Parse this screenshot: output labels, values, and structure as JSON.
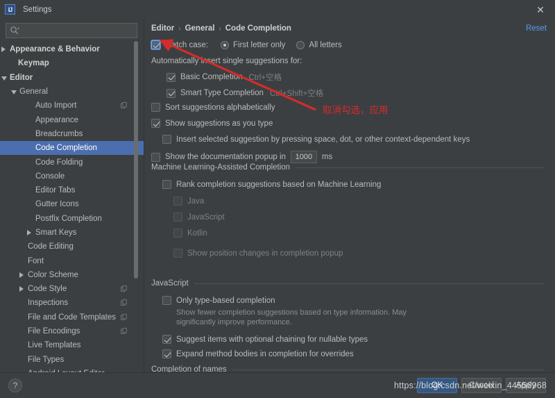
{
  "window": {
    "title": "Settings",
    "app_icon_text": "IJ",
    "close_label": "✕"
  },
  "search": {
    "placeholder": "",
    "value": "",
    "icon": "search-icon"
  },
  "sidebar": {
    "items": [
      {
        "label": "Appearance & Behavior",
        "indent": 14,
        "twisty": "closed",
        "bold": true,
        "selected": false,
        "icon": ""
      },
      {
        "label": "Keymap",
        "indent": 26,
        "twisty": "none",
        "bold": true,
        "selected": false,
        "icon": ""
      },
      {
        "label": "Editor",
        "indent": 14,
        "twisty": "open",
        "bold": true,
        "selected": false,
        "icon": ""
      },
      {
        "label": "General",
        "indent": 28,
        "twisty": "open",
        "bold": false,
        "selected": false,
        "icon": ""
      },
      {
        "label": "Auto Import",
        "indent": 51,
        "twisty": "none",
        "bold": false,
        "selected": false,
        "icon": "copy-icon"
      },
      {
        "label": "Appearance",
        "indent": 51,
        "twisty": "none",
        "bold": false,
        "selected": false,
        "icon": ""
      },
      {
        "label": "Breadcrumbs",
        "indent": 51,
        "twisty": "none",
        "bold": false,
        "selected": false,
        "icon": ""
      },
      {
        "label": "Code Completion",
        "indent": 51,
        "twisty": "none",
        "bold": false,
        "selected": true,
        "icon": ""
      },
      {
        "label": "Code Folding",
        "indent": 51,
        "twisty": "none",
        "bold": false,
        "selected": false,
        "icon": ""
      },
      {
        "label": "Console",
        "indent": 51,
        "twisty": "none",
        "bold": false,
        "selected": false,
        "icon": ""
      },
      {
        "label": "Editor Tabs",
        "indent": 51,
        "twisty": "none",
        "bold": false,
        "selected": false,
        "icon": ""
      },
      {
        "label": "Gutter Icons",
        "indent": 51,
        "twisty": "none",
        "bold": false,
        "selected": false,
        "icon": ""
      },
      {
        "label": "Postfix Completion",
        "indent": 51,
        "twisty": "none",
        "bold": false,
        "selected": false,
        "icon": ""
      },
      {
        "label": "Smart Keys",
        "indent": 51,
        "twisty": "closed",
        "bold": false,
        "selected": false,
        "icon": ""
      },
      {
        "label": "Code Editing",
        "indent": 40,
        "twisty": "none",
        "bold": false,
        "selected": false,
        "icon": ""
      },
      {
        "label": "Font",
        "indent": 40,
        "twisty": "none",
        "bold": false,
        "selected": false,
        "icon": ""
      },
      {
        "label": "Color Scheme",
        "indent": 40,
        "twisty": "closed",
        "bold": false,
        "selected": false,
        "icon": ""
      },
      {
        "label": "Code Style",
        "indent": 40,
        "twisty": "closed",
        "bold": false,
        "selected": false,
        "icon": "copy-icon"
      },
      {
        "label": "Inspections",
        "indent": 40,
        "twisty": "none",
        "bold": false,
        "selected": false,
        "icon": "copy-icon"
      },
      {
        "label": "File and Code Templates",
        "indent": 40,
        "twisty": "none",
        "bold": false,
        "selected": false,
        "icon": "copy-icon"
      },
      {
        "label": "File Encodings",
        "indent": 40,
        "twisty": "none",
        "bold": false,
        "selected": false,
        "icon": "copy-icon"
      },
      {
        "label": "Live Templates",
        "indent": 40,
        "twisty": "none",
        "bold": false,
        "selected": false,
        "icon": ""
      },
      {
        "label": "File Types",
        "indent": 40,
        "twisty": "none",
        "bold": false,
        "selected": false,
        "icon": ""
      },
      {
        "label": "Android Layout Editor",
        "indent": 40,
        "twisty": "none",
        "bold": false,
        "selected": false,
        "icon": ""
      }
    ]
  },
  "breadcrumb": {
    "parts": [
      "Editor",
      "General",
      "Code Completion"
    ],
    "separator": "›"
  },
  "reset": {
    "label": "Reset"
  },
  "options": {
    "match_case": {
      "label": "Match case:",
      "checked": true,
      "radios": [
        {
          "label": "First letter only",
          "selected": true
        },
        {
          "label": "All letters",
          "selected": false
        }
      ]
    },
    "auto_insert_header": "Automatically insert single suggestions for:",
    "basic_completion": {
      "label": "Basic Completion",
      "shortcut": "Ctrl+空格",
      "checked": true
    },
    "smart_type_completion": {
      "label": "Smart Type Completion",
      "shortcut": "Ctrl+Shift+空格",
      "checked": true
    },
    "sort_alphabetically": {
      "label": "Sort suggestions alphabetically",
      "checked": false
    },
    "show_as_you_type": {
      "label": "Show suggestions as you type",
      "checked": true
    },
    "insert_by_keys": {
      "label": "Insert selected suggestion by pressing space, dot, or other context-dependent keys",
      "checked": false
    },
    "doc_popup": {
      "label": "Show the documentation popup in",
      "checked": false,
      "value": "1000",
      "unit": "ms"
    }
  },
  "ml_section": {
    "title": "Machine Learning-Assisted Completion",
    "rank": {
      "label": "Rank completion suggestions based on Machine Learning",
      "checked": false
    },
    "languages": [
      {
        "label": "Java",
        "checked": false
      },
      {
        "label": "JavaScript",
        "checked": false
      },
      {
        "label": "Kotlin",
        "checked": false
      }
    ],
    "show_position_changes": {
      "label": "Show position changes in completion popup",
      "checked": false
    }
  },
  "js_section": {
    "title": "JavaScript",
    "only_type_based": {
      "label": "Only type-based completion",
      "checked": false
    },
    "only_type_based_desc_line1": "Show fewer completion suggestions based on type information. May",
    "only_type_based_desc_line2": "significantly improve performance.",
    "optional_chaining": {
      "label": "Suggest items with optional chaining for nullable types",
      "checked": true
    },
    "expand_method_bodies": {
      "label": "Expand method bodies in completion for overrides",
      "checked": true
    },
    "next_section_clipped": "Completion of names"
  },
  "footer": {
    "help_label": "?",
    "ok_label": "OK",
    "cancel_label": "Cancel",
    "apply_label": "Apply"
  },
  "watermark": {
    "text": "https://blog.csdn.net/weixin_44556968"
  },
  "annotation": {
    "text": "取消勾选，应用",
    "color": "#d42b2b"
  },
  "colors": {
    "window_bg": "#3c3f41",
    "selection_blue": "#4b6eaf",
    "link_blue": "#589df6",
    "ok_button": "#365880",
    "annotation_red": "#d42b2b"
  }
}
